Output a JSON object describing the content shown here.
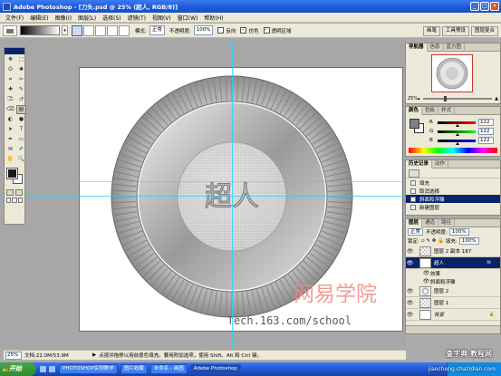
{
  "window": {
    "title": "Adobe Photoshop - [刀头.psd @ 25% (超人, RGB/8)]",
    "controls": [
      "_",
      "□",
      "×"
    ]
  },
  "menu": [
    "文件(F)",
    "编辑(E)",
    "图像(I)",
    "图层(L)",
    "选择(S)",
    "滤镜(T)",
    "视图(V)",
    "窗口(W)",
    "帮助(H)"
  ],
  "options": {
    "mode_label": "模式:",
    "mode_value": "正常",
    "opacity_label": "不透明度:",
    "opacity_value": "100%",
    "reverse_label": "反向",
    "reverse_checked": false,
    "dither_label": "仿色",
    "dither_checked": true,
    "transparency_label": "透明区域",
    "transparency_checked": true
  },
  "well_tabs": [
    "画笔",
    "工具预设",
    "图层复合"
  ],
  "toolbox": {
    "icons": [
      "move-icon",
      "marquee-icon",
      "lasso-icon",
      "magic-wand-icon",
      "crop-icon",
      "slice-icon",
      "healing-icon",
      "brush-icon",
      "stamp-icon",
      "history-brush-icon",
      "eraser-icon",
      "gradient-icon",
      "blur-icon",
      "dodge-icon",
      "path-select-icon",
      "type-icon",
      "pen-icon",
      "shape-icon",
      "notes-icon",
      "eyedropper-icon",
      "hand-icon",
      "zoom-icon"
    ],
    "glyphs": [
      "✥",
      "⬚",
      "ʘ",
      "✱",
      "⌗",
      "✂",
      "✚",
      "✎",
      "⎄",
      "↺",
      "⌫",
      "▤",
      "◐",
      "●",
      "➤",
      "T",
      "✒",
      "▭",
      "✉",
      "✐",
      "✋",
      "🔍"
    ],
    "selected_index": 11
  },
  "canvas": {
    "text": "超人",
    "watermark_cn": "网易学院",
    "watermark_url": "Tech.163.com/school"
  },
  "status": {
    "zoom": "25%",
    "doc": "文档:22.0M/53.9M",
    "hint": "点按并拖移以用前景色填充。要用附加选项，使用 Shift、Alt 和 Ctrl 键。"
  },
  "navigator": {
    "tabs": [
      "导航器",
      "信息",
      "直方图"
    ],
    "zoom": "25%"
  },
  "color": {
    "tabs": [
      "颜色",
      "色板",
      "样式"
    ],
    "channels": [
      {
        "label": "R",
        "value": "122"
      },
      {
        "label": "G",
        "value": "122"
      },
      {
        "label": "B",
        "value": "122"
      }
    ]
  },
  "history": {
    "tabs": [
      "历史记录",
      "动作"
    ],
    "items": [
      "填充",
      "取消选择",
      "斜面和浮雕",
      "新建图层"
    ],
    "active_index": 2
  },
  "layers": {
    "tabs": [
      "图层",
      "通道",
      "路径"
    ],
    "blend": "正常",
    "opacity_label": "不透明度:",
    "opacity": "100%",
    "lock_label": "锁定:",
    "fill_label": "填充:",
    "fill": "100%",
    "items": [
      {
        "name": "图层 2 副本 187",
        "thumb": "t-check",
        "kind": "layer"
      },
      {
        "name": "超人",
        "thumb": "t-text",
        "thumb_text": "T",
        "kind": "layer",
        "active": true,
        "fx": "fx"
      },
      {
        "name": "效果",
        "kind": "sub"
      },
      {
        "name": "斜面和浮雕",
        "kind": "sub"
      },
      {
        "name": "图层 2",
        "thumb": "t-ring",
        "kind": "layer"
      },
      {
        "name": "图层 1",
        "thumb": "t-check",
        "kind": "layer"
      },
      {
        "name": "背景",
        "thumb": "",
        "kind": "background"
      }
    ]
  },
  "taskbar": {
    "start": "开始",
    "tasks": [
      "PHOTOSHOP实例教学",
      "图片收藏",
      "未命名 - 画图",
      "Adobe Photoshop"
    ],
    "active_index": 3
  },
  "site_watermark": {
    "line1": "查字典 教程网",
    "line2": "jiaocheng.chazidian.com"
  }
}
